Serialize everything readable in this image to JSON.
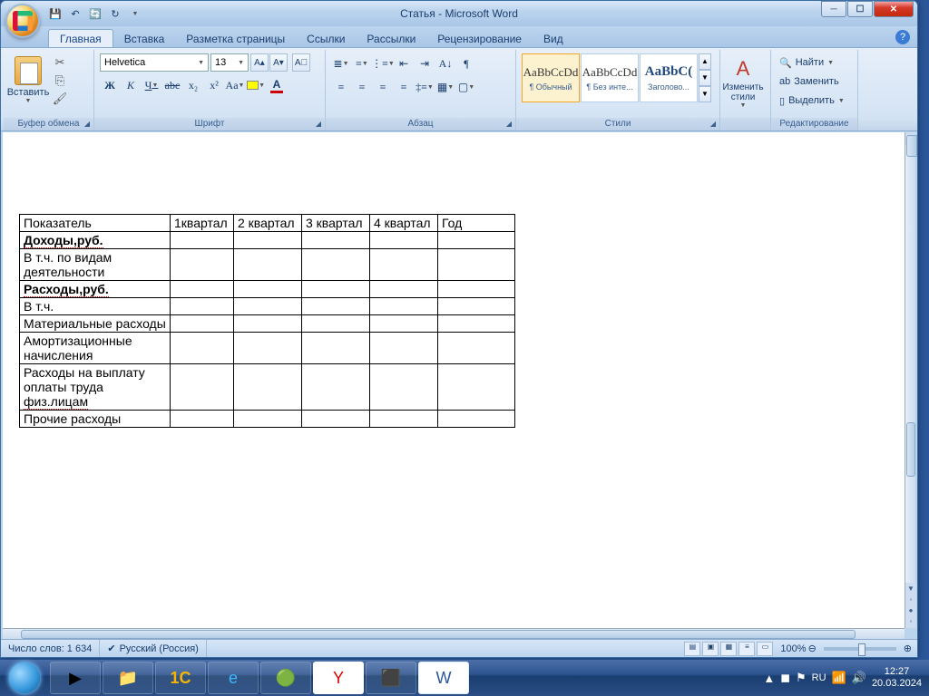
{
  "title": "Статья - Microsoft Word",
  "qat": {
    "save": "💾",
    "undo": "↶",
    "redo": "↻",
    "refresh": "🔄"
  },
  "tabs": [
    "Главная",
    "Вставка",
    "Разметка страницы",
    "Ссылки",
    "Рассылки",
    "Рецензирование",
    "Вид"
  ],
  "ribbon": {
    "clipboard": {
      "label": "Буфер обмена",
      "paste": "Вставить"
    },
    "font": {
      "label": "Шрифт",
      "name": "Helvetica",
      "size": "13"
    },
    "paragraph": {
      "label": "Абзац"
    },
    "styles": {
      "label": "Стили",
      "items": [
        {
          "preview": "AaBbCcDd",
          "name": "¶ Обычный"
        },
        {
          "preview": "AaBbCcDd",
          "name": "¶ Без инте..."
        },
        {
          "preview": "AaBbC(",
          "name": "Заголово..."
        }
      ],
      "change": "Изменить стили"
    },
    "editing": {
      "label": "Редактирование",
      "find": "Найти",
      "replace": "Заменить",
      "select": "Выделить"
    }
  },
  "table": {
    "headers": [
      "Показатель",
      "1квартал",
      "2 квартал",
      "3 квартал",
      "4 квартал",
      "Год"
    ],
    "rows": [
      {
        "label": "Доходы,руб.",
        "bold": true,
        "spell": true
      },
      {
        "label": "В т.ч. по видам деятельности"
      },
      {
        "label": "Расходы,руб.",
        "bold": true,
        "spell": true
      },
      {
        "label": "В т.ч."
      },
      {
        "label": "Материальные расходы"
      },
      {
        "label": "Амортизационные начисления"
      },
      {
        "label": "Расходы на выплату оплаты труда физ.лицам",
        "spell_partial": "физ.лицам"
      },
      {
        "label": "Прочие расходы"
      }
    ]
  },
  "status": {
    "words": "Число слов: 1 634",
    "lang": "Русский (Россия)",
    "zoom": "100%"
  },
  "taskbar": {
    "lang": "RU",
    "time": "12:27",
    "date": "20.03.2024"
  }
}
